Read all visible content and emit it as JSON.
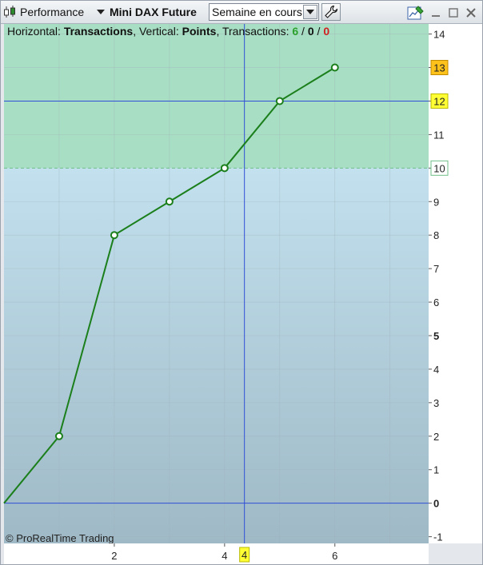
{
  "toolbar": {
    "title": "Performance",
    "instrument": "Mini DAX Future",
    "period": "Semaine en cours",
    "icons": [
      "candlestick-icon",
      "dropdown-arrow-icon",
      "wrench-icon",
      "edit-chart-icon",
      "close-icon",
      "maximize-icon",
      "minimize-icon"
    ]
  },
  "chart_header": {
    "h_prefix": "Horizontal: ",
    "h_value": "Transactions",
    "v_prefix": ", Vertical: ",
    "v_value": "Points",
    "t_prefix": ", Transactions: ",
    "t_win": "6",
    "sep1": " / ",
    "t_neutral": "0",
    "sep2": " / ",
    "t_loss": "0"
  },
  "copyright": "© ProRealTime Trading",
  "colors": {
    "profit_zone": "#a8dec3",
    "loss_zone_top": "#c2e0ee",
    "loss_zone_bottom": "#9fb9c6",
    "line": "#1b7f1b",
    "crosshair": "#2f4fd6",
    "tag_yellow": "#ffff33",
    "tag_orange": "#ffc21a",
    "win": "#2ca02c",
    "loss": "#d02020"
  },
  "chart_data": {
    "type": "line",
    "x": [
      0,
      1,
      2,
      3,
      4,
      5,
      6
    ],
    "y": [
      0,
      2,
      8,
      9,
      10,
      12,
      13
    ],
    "xlim": [
      0,
      7.7
    ],
    "ylim": [
      -1.2,
      14.3
    ],
    "x_ticks": [
      "2",
      "4",
      "6"
    ],
    "x_tick_values": [
      2,
      4,
      6
    ],
    "y_ticks": [
      "-1",
      "0",
      "1",
      "2",
      "3",
      "4",
      "5",
      "6",
      "7",
      "8",
      "9",
      "10",
      "11",
      "12",
      "13",
      "14"
    ],
    "y_tick_values": [
      -1,
      0,
      1,
      2,
      3,
      4,
      5,
      6,
      7,
      8,
      9,
      10,
      11,
      12,
      13,
      14
    ],
    "bold_y_ticks": [
      "0",
      "5"
    ],
    "reference_level": 10,
    "crosshair": {
      "x": 4.36,
      "y": 12,
      "x_label": "4",
      "y_label": "12"
    },
    "last_value_label": "13",
    "reference_label": "10",
    "grid": true
  }
}
